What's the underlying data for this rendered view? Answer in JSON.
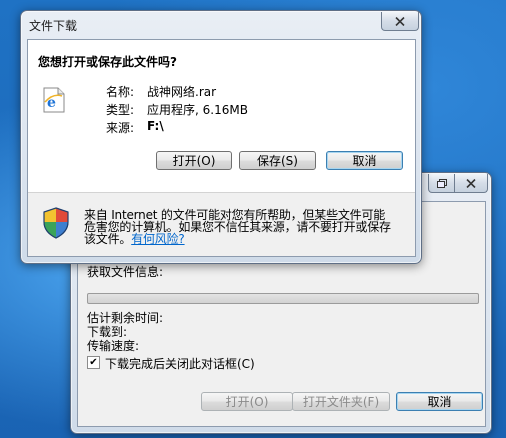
{
  "progress_window": {
    "progress": 0,
    "labels": {
      "getting_info": "获取文件信息:",
      "time_left": "估计剩余时间:",
      "download_to": "下载到:",
      "transfer_rate": "传输速度:"
    },
    "close_checkbox": {
      "label": "下载完成后关闭此对话框(C)",
      "checked": true
    },
    "buttons": {
      "open": "打开(O)",
      "open_folder": "打开文件夹(F)",
      "cancel": "取消"
    }
  },
  "download_dialog": {
    "title": "文件下载",
    "question": "您想打开或保存此文件吗?",
    "file": {
      "name_label": "名称:",
      "name": "战神网络.rar",
      "type_label": "类型:",
      "type": "应用程序, 6.16MB",
      "from_label": "来源:",
      "from": "F:\\"
    },
    "buttons": {
      "open": "打开(O)",
      "save": "保存(S)",
      "cancel": "取消"
    },
    "warning": {
      "line1": "来自 Internet 的文件可能对您有所帮助，但某些文件可能",
      "line2": "危害您的计算机。如果您不信任其来源，请不要打开或保存",
      "line3": "该文件。",
      "link": "有何风险?"
    }
  },
  "icons": [
    "ie-file-icon",
    "shield-icon",
    "close-icon",
    "restore-icon"
  ]
}
